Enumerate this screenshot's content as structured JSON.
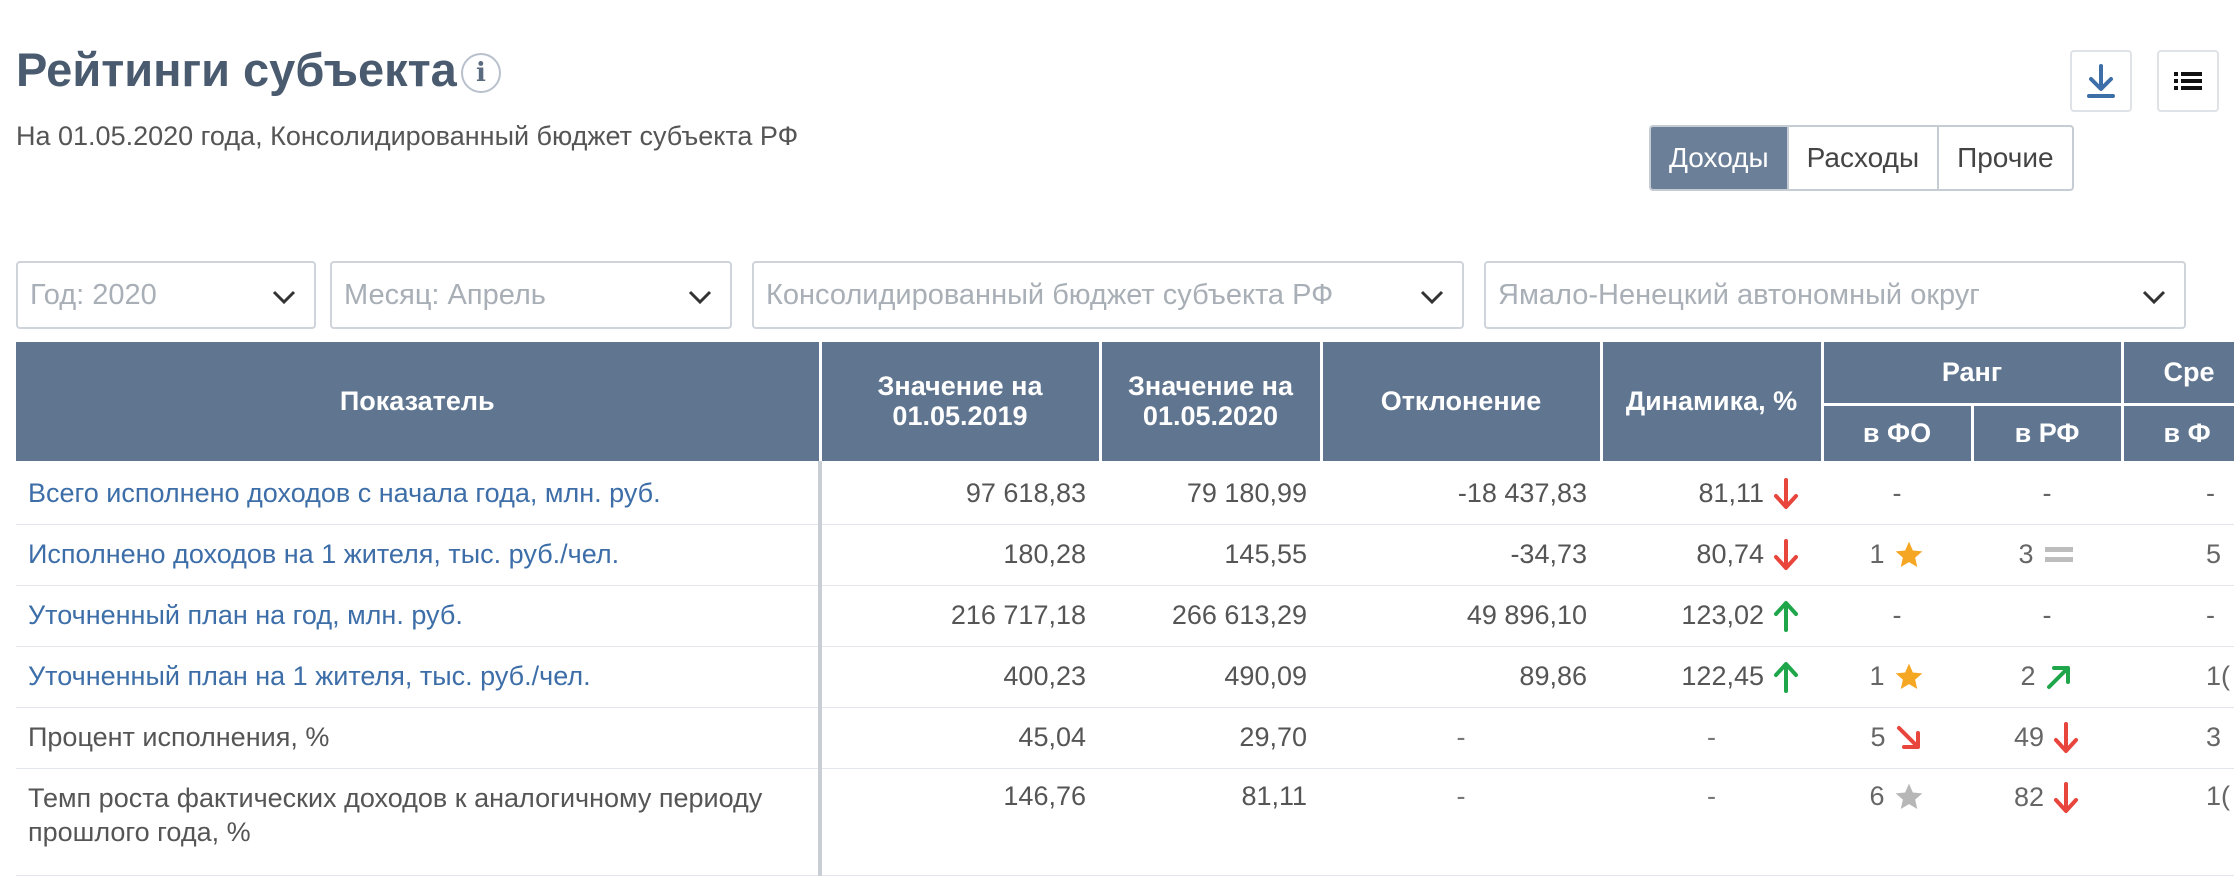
{
  "header": {
    "title": "Рейтинги субъекта",
    "info_icon": "info-icon",
    "subtitle": "На 01.05.2020 года, Консолидированный бюджет субъекта РФ"
  },
  "toolbar": {
    "download_icon": "download-icon",
    "list_icon": "list-icon"
  },
  "tabs": [
    {
      "label": "Доходы",
      "active": true
    },
    {
      "label": "Расходы",
      "active": false
    },
    {
      "label": "Прочие",
      "active": false
    }
  ],
  "filters": {
    "year": "Год: 2020",
    "month": "Месяц: Апрель",
    "budget": "Консолидированный бюджет субъекта РФ",
    "region": "Ямало-Ненецкий автономный округ"
  },
  "table": {
    "headers": {
      "indicator": "Показатель",
      "value_2019": "Значение на 01.05.2019",
      "value_2020": "Значение на 01.05.2020",
      "deviation": "Отклонение",
      "dynamics": "Динамика, %",
      "rank": "Ранг",
      "rank_fo": "в ФО",
      "rank_rf": "в РФ",
      "avg": "Сре",
      "avg_fo": "в Ф"
    },
    "rows": [
      {
        "name": "Всего исполнено доходов с начала года, млн. руб.",
        "link": true,
        "v2019": "97 618,83",
        "v2020": "79 180,99",
        "dev": "-18 437,83",
        "dyn": "81,11",
        "dyn_icon": "arrow-down",
        "rank_fo": "-",
        "rank_fo_icon": "",
        "rank_rf": "-",
        "rank_rf_icon": "",
        "avg": "-"
      },
      {
        "name": "Исполнено доходов на 1 жителя, тыс. руб./чел.",
        "link": true,
        "v2019": "180,28",
        "v2020": "145,55",
        "dev": "-34,73",
        "dyn": "80,74",
        "dyn_icon": "arrow-down",
        "rank_fo": "1",
        "rank_fo_icon": "star-orange",
        "rank_rf": "3",
        "rank_rf_icon": "equal",
        "avg": "5"
      },
      {
        "name": "Уточненный план на год, млн. руб.",
        "link": true,
        "v2019": "216 717,18",
        "v2020": "266 613,29",
        "dev": "49 896,10",
        "dyn": "123,02",
        "dyn_icon": "arrow-up",
        "rank_fo": "-",
        "rank_fo_icon": "",
        "rank_rf": "-",
        "rank_rf_icon": "",
        "avg": "-"
      },
      {
        "name": "Уточненный план на 1 жителя, тыс. руб./чел.",
        "link": true,
        "v2019": "400,23",
        "v2020": "490,09",
        "dev": "89,86",
        "dyn": "122,45",
        "dyn_icon": "arrow-up",
        "rank_fo": "1",
        "rank_fo_icon": "star-orange",
        "rank_rf": "2",
        "rank_rf_icon": "arrow-up-right",
        "avg": "1("
      },
      {
        "name": "Процент исполнения, %",
        "link": false,
        "v2019": "45,04",
        "v2020": "29,70",
        "dev": "-",
        "dyn": "-",
        "dyn_icon": "",
        "rank_fo": "5",
        "rank_fo_icon": "arrow-down-right",
        "rank_rf": "49",
        "rank_rf_icon": "arrow-down",
        "avg": "3"
      },
      {
        "name": "Темп роста фактических доходов к аналогичному периоду прошлого года, %",
        "link": false,
        "v2019": "146,76",
        "v2020": "81,11",
        "dev": "-",
        "dyn": "-",
        "dyn_icon": "",
        "rank_fo": "6",
        "rank_fo_icon": "star-gray",
        "rank_rf": "82",
        "rank_rf_icon": "arrow-down",
        "avg": "1("
      }
    ]
  },
  "colors": {
    "header_bg": "#5f7590",
    "link": "#3d6ea8",
    "up": "#1fa64a",
    "down": "#e8453c",
    "star": "#f5a623",
    "tab_active": "#6b7f99"
  }
}
